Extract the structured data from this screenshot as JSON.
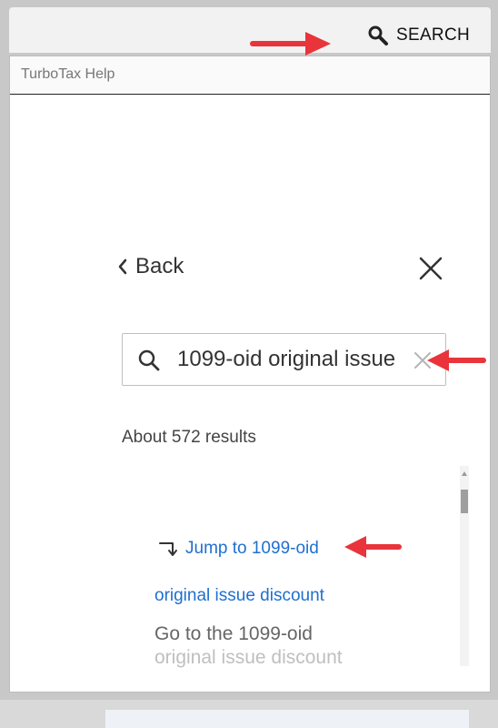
{
  "header": {
    "search_label": "SEARCH",
    "search_icon": "search-icon"
  },
  "window": {
    "title": "TurboTax Help"
  },
  "panel": {
    "back_label": "Back",
    "back_icon": "chevron-left-icon",
    "close_icon": "close-icon"
  },
  "search": {
    "value": "1099-oid original issue",
    "icon": "search-icon",
    "clear_icon": "clear-icon"
  },
  "results": {
    "count_label": "About 572 results",
    "jump_label": "Jump to 1099-oid",
    "jump_icon": "corner-down-right-arrow-icon",
    "items": [
      {
        "title": "original issue discount",
        "snippet_line1": "Go to the 1099-oid",
        "snippet_line2": "original issue discount"
      }
    ]
  },
  "colors": {
    "link_blue": "#1f6fcf",
    "annotation_red": "#e8343a",
    "text_gray": "#666666"
  }
}
